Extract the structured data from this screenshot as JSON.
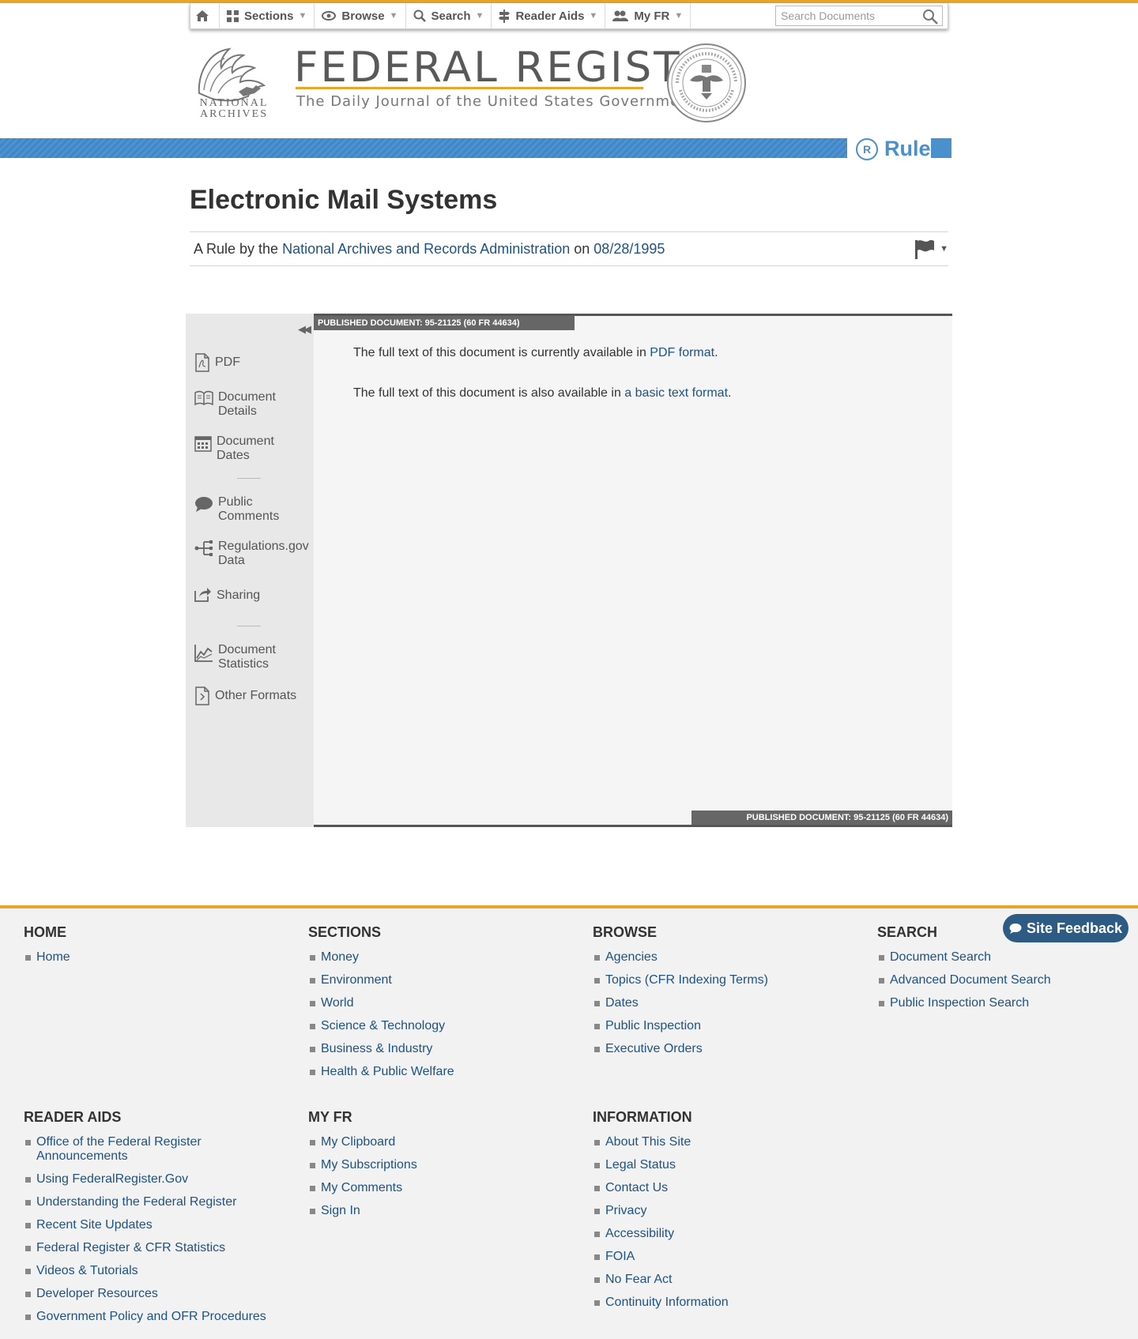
{
  "nav": {
    "items": [
      {
        "label": "Sections",
        "icon": "grid-icon"
      },
      {
        "label": "Browse",
        "icon": "eye-icon"
      },
      {
        "label": "Search",
        "icon": "search-icon"
      },
      {
        "label": "Reader Aids",
        "icon": "signpost-icon"
      },
      {
        "label": "My FR",
        "icon": "users-icon"
      }
    ],
    "search_placeholder": "Search Documents"
  },
  "header": {
    "archives_line1": "NATIONAL",
    "archives_line2": "ARCHIVES",
    "title": "FEDERAL REGISTER",
    "subtitle": "The Daily Journal of the United States Government"
  },
  "doc_type": {
    "letter": "R",
    "label": "Rule"
  },
  "document": {
    "title": "Electronic Mail Systems",
    "byline_prefix": "A Rule by the",
    "agency": "National Archives and Records Administration",
    "byline_on": "on",
    "date": "08/28/1995"
  },
  "sidebar": {
    "items": [
      {
        "label": "PDF",
        "icon": "pdf-icon"
      },
      {
        "label": "Document Details",
        "icon": "book-icon"
      },
      {
        "label": "Document Dates",
        "icon": "calendar-icon"
      },
      {
        "label": "Public Comments",
        "icon": "comment-icon"
      },
      {
        "label": "Regulations.gov Data",
        "icon": "branch-icon"
      },
      {
        "label": "Sharing",
        "icon": "share-icon"
      },
      {
        "label": "Document Statistics",
        "icon": "chart-icon"
      },
      {
        "label": "Other Formats",
        "icon": "file-icon"
      }
    ]
  },
  "main": {
    "published_tag": "PUBLISHED DOCUMENT: 95-21125 (60 FR 44634)",
    "para1_text": "The full text of this document is currently available in",
    "para1_link": "PDF format",
    "para2_text": "The full text of this document is also available in",
    "para2_link": "a basic text format"
  },
  "footer": {
    "feedback": "Site Feedback",
    "columns": [
      {
        "heading": "HOME",
        "links": [
          "Home"
        ]
      },
      {
        "heading": "SECTIONS",
        "links": [
          "Money",
          "Environment",
          "World",
          "Science & Technology",
          "Business & Industry",
          "Health & Public Welfare"
        ]
      },
      {
        "heading": "BROWSE",
        "links": [
          "Agencies",
          "Topics (CFR Indexing Terms)",
          "Dates",
          "Public Inspection",
          "Executive Orders"
        ]
      },
      {
        "heading": "SEARCH",
        "links": [
          "Document Search",
          "Advanced Document Search",
          "Public Inspection Search"
        ]
      },
      {
        "heading": "READER AIDS",
        "links": [
          "Office of the Federal Register Announcements",
          "Using FederalRegister.Gov",
          "Understanding the Federal Register",
          "Recent Site Updates",
          "Federal Register & CFR Statistics",
          "Videos & Tutorials",
          "Developer Resources",
          "Government Policy and OFR Procedures"
        ]
      },
      {
        "heading": "MY FR",
        "links": [
          "My Clipboard",
          "My Subscriptions",
          "My Comments",
          "Sign In"
        ]
      },
      {
        "heading": "INFORMATION",
        "links": [
          "About This Site",
          "Legal Status",
          "Contact Us",
          "Privacy",
          "Accessibility",
          "FOIA",
          "No Fear Act",
          "Continuity Information"
        ]
      }
    ]
  }
}
